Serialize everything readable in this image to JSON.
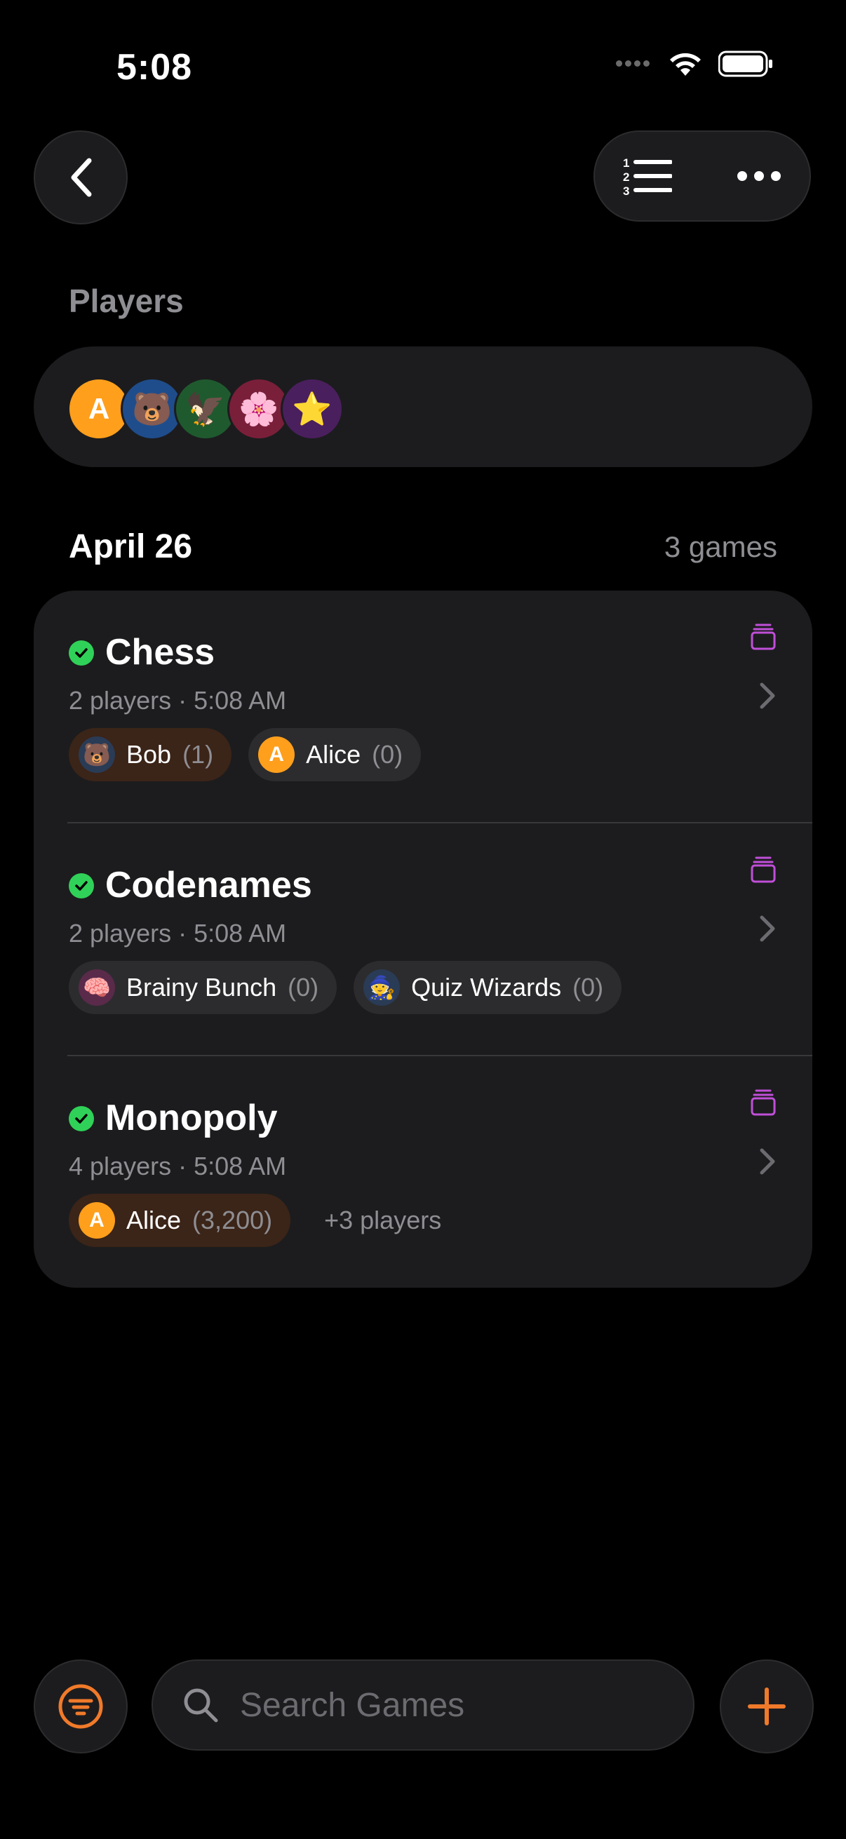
{
  "status": {
    "time": "5:08"
  },
  "players_section": {
    "title": "Players"
  },
  "players": [
    {
      "name": "A",
      "icon": "letter-a"
    },
    {
      "name": "bear",
      "icon": "🐻"
    },
    {
      "name": "eagle",
      "icon": "🦅"
    },
    {
      "name": "flower",
      "icon": "🌸"
    },
    {
      "name": "star",
      "icon": "⭐"
    }
  ],
  "day": {
    "date": "April 26",
    "count": "3 games"
  },
  "games": [
    {
      "title": "Chess",
      "subtitle": "2 players · 5:08 AM",
      "chips": [
        {
          "icon": "🐻",
          "name": "Bob",
          "score": "(1)"
        },
        {
          "icon": "A",
          "name": "Alice",
          "score": "(0)"
        }
      ]
    },
    {
      "title": "Codenames",
      "subtitle": "2 players · 5:08 AM",
      "chips": [
        {
          "icon": "🧠",
          "name": "Brainy Bunch",
          "score": "(0)"
        },
        {
          "icon": "🧙",
          "name": "Quiz Wizards",
          "score": "(0)"
        }
      ]
    },
    {
      "title": "Monopoly",
      "subtitle": "4 players · 5:08 AM",
      "chips": [
        {
          "icon": "A",
          "name": "Alice",
          "score": "(3,200)"
        }
      ],
      "more": "+3 players"
    }
  ],
  "search": {
    "placeholder": "Search Games"
  },
  "colors": {
    "accent": "#f07a2a",
    "success": "#30d158",
    "stack": "#c04fd8"
  }
}
